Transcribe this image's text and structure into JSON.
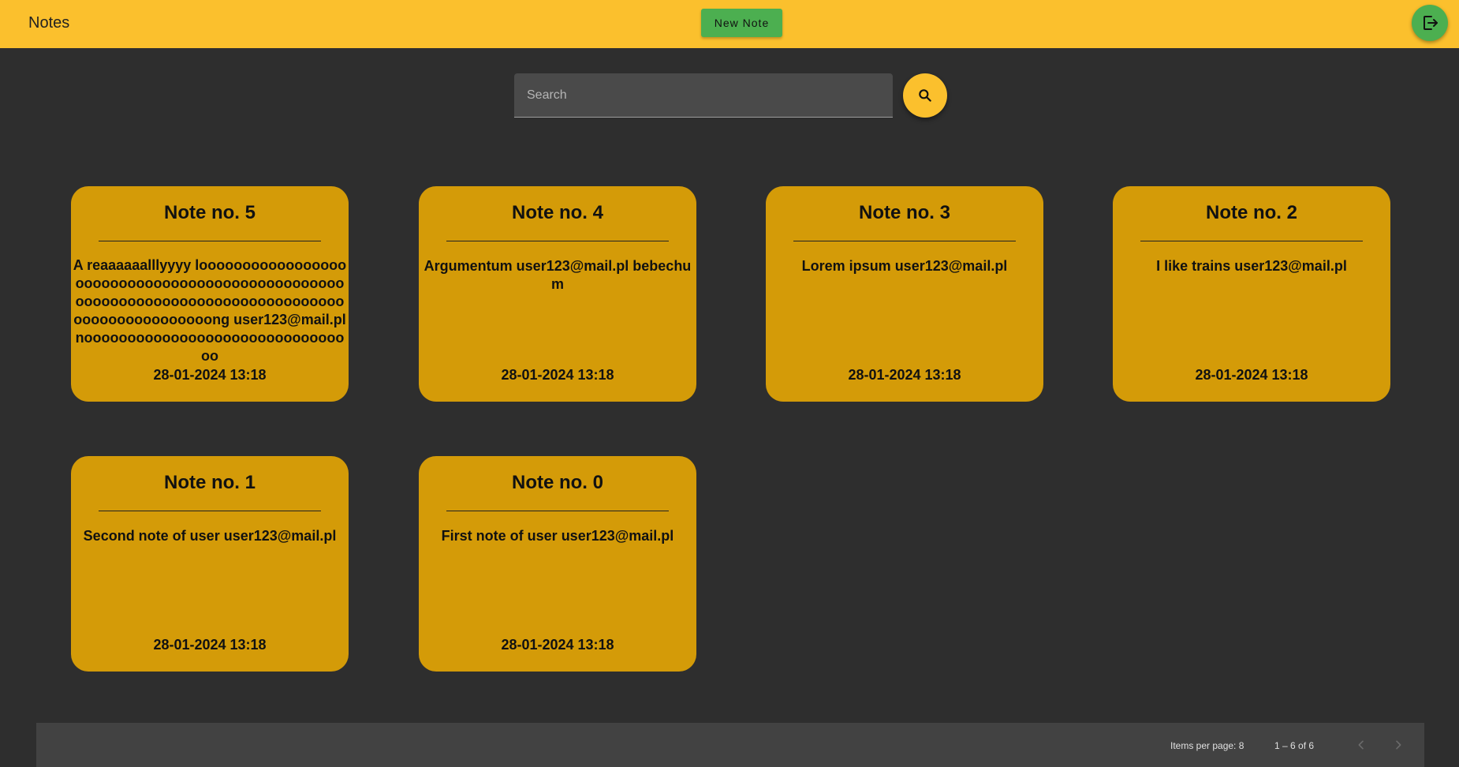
{
  "header": {
    "title": "Notes",
    "new_note_label": "New Note",
    "logout_icon": "logout-icon"
  },
  "search": {
    "placeholder": "Search",
    "value": "",
    "icon": "search-icon"
  },
  "notes": [
    {
      "title": "Note no. 5",
      "content": "A reaaaaaalllyyyy looooooooooooooooooooooooooooooooooooooooooooooooooooooooooooooooooooooooooooooooooooooooooooooong user123@mail.pl noooooooooooooooooooooooooooooooo",
      "date": "28-01-2024 13:18"
    },
    {
      "title": "Note no. 4",
      "content": "Argumentum user123@mail.pl bebechum",
      "date": "28-01-2024 13:18"
    },
    {
      "title": "Note no. 3",
      "content": "Lorem ipsum user123@mail.pl",
      "date": "28-01-2024 13:18"
    },
    {
      "title": "Note no. 2",
      "content": "I like trains user123@mail.pl",
      "date": "28-01-2024 13:18"
    },
    {
      "title": "Note no. 1",
      "content": "Second note of user user123@mail.pl",
      "date": "28-01-2024 13:18"
    },
    {
      "title": "Note no. 0",
      "content": "First note of user user123@mail.pl",
      "date": "28-01-2024 13:18"
    }
  ],
  "paginator": {
    "items_per_page_label": "Items per page: 8",
    "range_label": "1 – 6 of 6",
    "prev_icon": "chevron-left-icon",
    "next_icon": "chevron-right-icon"
  },
  "colors": {
    "topbar": "#fbc02d",
    "background": "#2e2e2e",
    "card": "#d49b08",
    "accent_green": "#4caf50",
    "paginator": "#424242"
  }
}
